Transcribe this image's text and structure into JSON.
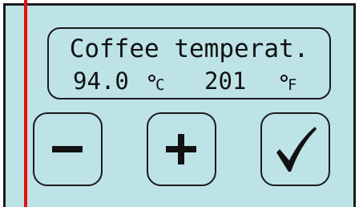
{
  "display": {
    "title": "Coffee temperat.",
    "celsius_value": "94.0",
    "celsius_unit": "C",
    "fahrenheit_value": "201",
    "fahrenheit_unit": "F"
  },
  "buttons": {
    "decrease_icon": "minus-icon",
    "increase_icon": "plus-icon",
    "confirm_icon": "checkmark-icon"
  },
  "colors": {
    "panel_background": "#bde3e7",
    "border": "#1a1a1a",
    "red_marker": "#e8100c"
  }
}
